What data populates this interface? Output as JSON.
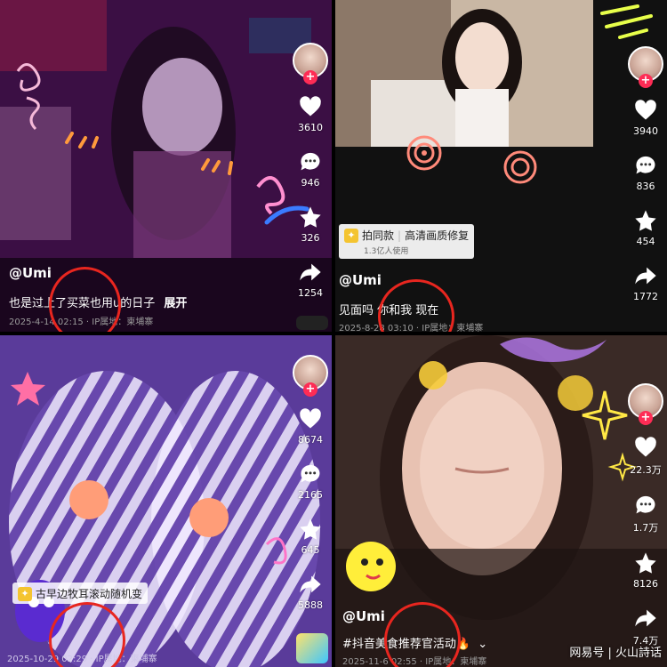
{
  "colors": {
    "accent": "#fe2c55",
    "circle": "#e8261f",
    "meta_text": "#9a9a9a"
  },
  "panels": [
    {
      "icons": [
        "avatar",
        "plus-icon",
        "heart-icon",
        "comment-icon",
        "star-icon",
        "share-icon"
      ],
      "likes": "3610",
      "comments": "946",
      "favorites": "326",
      "shares": "1254",
      "user": "@Umi",
      "caption": "也是过上了买菜也用u的日子",
      "expand": "展开",
      "meta": "2025-4-14 02:15 · IP属地：柬埔寨"
    },
    {
      "tag_title": "拍同款",
      "tag_extra": "高清画质修复",
      "tag_sub": "1.3亿人使用",
      "likes": "3940",
      "comments": "836",
      "favorites": "454",
      "shares": "1772",
      "user": "@Umi",
      "caption": "见面吗 你和我 现在",
      "meta": "2025-8-28 03:10 · IP属地：柬埔寨"
    },
    {
      "likes": "8674",
      "comments": "2165",
      "favorites": "645",
      "shares": "5888",
      "tag_title": "古早边牧耳滚动随机变",
      "meta": "2025-10-29 02:29 · IP属地：柬埔寨"
    },
    {
      "likes": "22.3万",
      "comments": "1.7万",
      "favorites": "8126",
      "shares": "7.4万",
      "user": "@Umi",
      "caption": "#抖音美食推荐官活动🔥",
      "meta": "2025-11-6 02:55 · IP属地：柬埔寨",
      "watermark": "网易号 | 火山詩话"
    }
  ]
}
